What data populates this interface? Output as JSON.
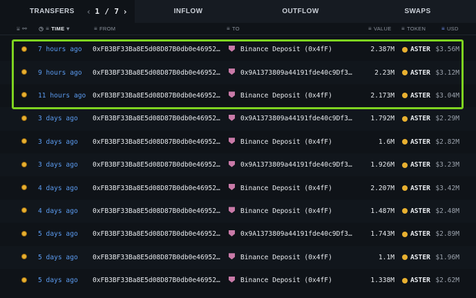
{
  "tabs": {
    "transfers": "TRANSFERS",
    "page": "1 / 7",
    "prev_icon": "chevron-left-icon",
    "next_icon": "chevron-right-icon",
    "inflow": "INFLOW",
    "outflow": "OUTFLOW",
    "swaps": "SWAPS"
  },
  "columns": {
    "time": "TIME",
    "from": "FROM",
    "to": "TO",
    "value": "VALUE",
    "token": "TOKEN",
    "usd": "USD"
  },
  "highlight_color": "#7ed320",
  "rows": [
    {
      "time": "7 hours ago",
      "from": "0xFB3BF33Ba8E5d08D87B0db0e46952…",
      "to": "Binance Deposit (0x4fF)",
      "value": "2.387M",
      "token": "ASTER",
      "usd": "$3.56M"
    },
    {
      "time": "9 hours ago",
      "from": "0xFB3BF33Ba8E5d08D87B0db0e46952…",
      "to": "0x9A1373809a44191fde40c9Df3…",
      "value": "2.23M",
      "token": "ASTER",
      "usd": "$3.12M"
    },
    {
      "time": "11 hours ago",
      "from": "0xFB3BF33Ba8E5d08D87B0db0e46952…",
      "to": "Binance Deposit (0x4fF)",
      "value": "2.173M",
      "token": "ASTER",
      "usd": "$3.04M"
    },
    {
      "time": "3 days ago",
      "from": "0xFB3BF33Ba8E5d08D87B0db0e46952…",
      "to": "0x9A1373809a44191fde40c9Df3…",
      "value": "1.792M",
      "token": "ASTER",
      "usd": "$2.29M"
    },
    {
      "time": "3 days ago",
      "from": "0xFB3BF33Ba8E5d08D87B0db0e46952…",
      "to": "Binance Deposit (0x4fF)",
      "value": "1.6M",
      "token": "ASTER",
      "usd": "$2.82M"
    },
    {
      "time": "3 days ago",
      "from": "0xFB3BF33Ba8E5d08D87B0db0e46952…",
      "to": "0x9A1373809a44191fde40c9Df3…",
      "value": "1.926M",
      "token": "ASTER",
      "usd": "$3.23M"
    },
    {
      "time": "4 days ago",
      "from": "0xFB3BF33Ba8E5d08D87B0db0e46952…",
      "to": "Binance Deposit (0x4fF)",
      "value": "2.207M",
      "token": "ASTER",
      "usd": "$3.42M"
    },
    {
      "time": "4 days ago",
      "from": "0xFB3BF33Ba8E5d08D87B0db0e46952…",
      "to": "Binance Deposit (0x4fF)",
      "value": "1.487M",
      "token": "ASTER",
      "usd": "$2.48M"
    },
    {
      "time": "5 days ago",
      "from": "0xFB3BF33Ba8E5d08D87B0db0e46952…",
      "to": "0x9A1373809a44191fde40c9Df3…",
      "value": "1.743M",
      "token": "ASTER",
      "usd": "$2.89M"
    },
    {
      "time": "5 days ago",
      "from": "0xFB3BF33Ba8E5d08D87B0db0e46952…",
      "to": "Binance Deposit (0x4fF)",
      "value": "1.1M",
      "token": "ASTER",
      "usd": "$1.96M"
    },
    {
      "time": "5 days ago",
      "from": "0xFB3BF33Ba8E5d08D87B0db0e46952…",
      "to": "Binance Deposit (0x4fF)",
      "value": "1.338M",
      "token": "ASTER",
      "usd": "$2.62M"
    }
  ]
}
